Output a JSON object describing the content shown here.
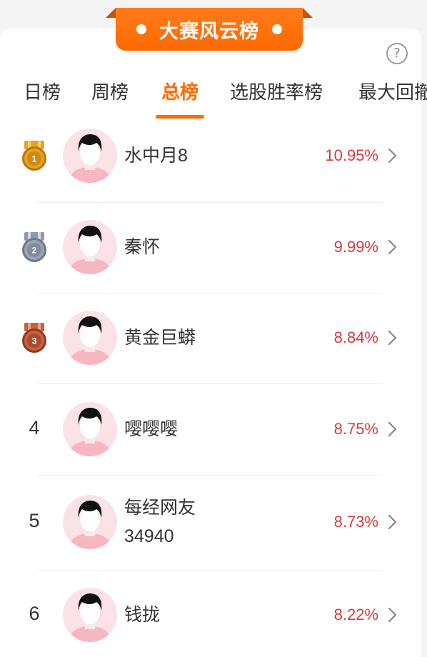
{
  "banner": {
    "title": "大赛风云榜"
  },
  "help": {
    "icon": "question-circle-icon",
    "label": "?"
  },
  "tabs": [
    {
      "label": "日榜",
      "active": false
    },
    {
      "label": "周榜",
      "active": false
    },
    {
      "label": "总榜",
      "active": true
    },
    {
      "label": "选股胜率榜",
      "active": false
    },
    {
      "label": "最大回撤",
      "active": false
    }
  ],
  "colors": {
    "accent": "#ff6a00",
    "return_red": "#d93a3a",
    "gold": "#e8a21f",
    "silver": "#9aa4b3",
    "bronze": "#c8613f",
    "avatar_bg": "#fbe2e6"
  },
  "rankings": [
    {
      "rank": "1",
      "medal": "gold",
      "name": "水中月8",
      "name_line2": "",
      "return": "10.95%"
    },
    {
      "rank": "2",
      "medal": "silver",
      "name": "秦怀",
      "name_line2": "",
      "return": "9.99%"
    },
    {
      "rank": "3",
      "medal": "bronze",
      "name": "黄金巨蟒",
      "name_line2": "",
      "return": "8.84%"
    },
    {
      "rank": "4",
      "medal": "",
      "name": "嘤嘤嘤",
      "name_line2": "",
      "return": "8.75%"
    },
    {
      "rank": "5",
      "medal": "",
      "name": "每经网友",
      "name_line2": "34940",
      "return": "8.73%"
    },
    {
      "rank": "6",
      "medal": "",
      "name": "钱拢",
      "name_line2": "",
      "return": "8.22%"
    }
  ]
}
